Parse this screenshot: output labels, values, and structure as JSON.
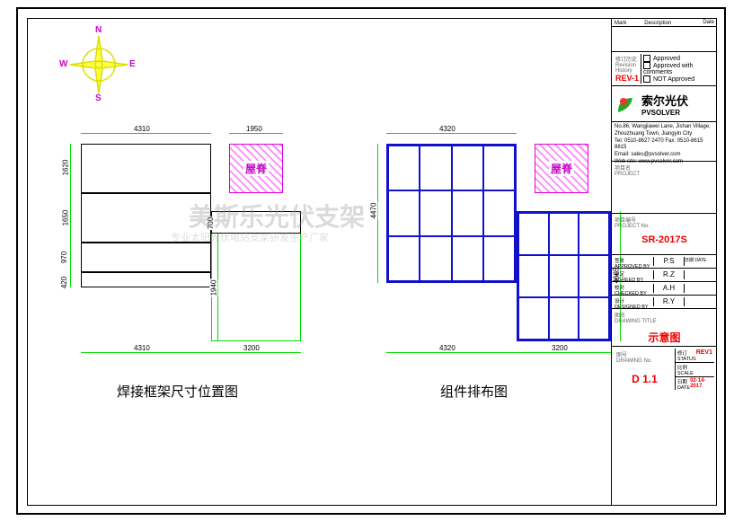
{
  "compass": {
    "n": "N",
    "s": "S",
    "e": "E",
    "w": "W"
  },
  "left_drawing": {
    "caption": "焊接框架尺寸位置图",
    "dims": {
      "top1": "4310",
      "top2": "1950",
      "bottom1": "4310",
      "bottom2": "3200",
      "left1": "1620",
      "left2": "1650",
      "left3": "970",
      "left4": "420",
      "right1": "700",
      "right2": "1940"
    },
    "hatch_label": "屋脊"
  },
  "right_drawing": {
    "caption": "组件排布图",
    "dims": {
      "top1": "4320",
      "bottom1": "4320",
      "bottom2": "3200",
      "right1": "4665",
      "left1": "4470"
    },
    "hatch_label": "屋脊"
  },
  "watermark": {
    "line1": "美斯乐光伏支架",
    "line2": "专业太阳光伏电站支架研发生产厂家"
  },
  "title_block": {
    "rev_header": {
      "mark": "Mark",
      "desc": "Description",
      "date": "Date"
    },
    "rev_history_label": "修订历史\nRevision History",
    "approval": {
      "a": "Approved",
      "b": "Approved with comments",
      "c": "NOT Approved"
    },
    "rev": "REV-1",
    "company_cn": "索尔光伏",
    "company_en": "PVSOLVER",
    "address": "No.86, Wangjiawei Lane, Jishan Village,\nZhouzhuang Town, Jiangyin City\nTel: 0510-8627 2470 Fax: 0510-8615 8815\nEmail: sales@pvsolver.com\nWeb site: www.pvsolver.com",
    "project_label": "项目名\nPROJECT",
    "project_no_label": "项目编号\nPROJECT No.",
    "project_no": "SR-2017S",
    "approved_by_label": "签发\nAPPROVED BY",
    "approved_by": "P.S",
    "agreed_by_label": "审定\nAGREED BY",
    "agreed_by": "R.Z",
    "checked_by_label": "校对\nCHECKED BY",
    "checked_by": "A.H",
    "designed_by_label": "设计\nDESIGNED BY",
    "designed_by": "R.Y",
    "date_col_label": "日期 DATE",
    "drawing_title_label": "图名\nDRAWING TITLE",
    "drawing_title": "示意图",
    "drawing_no_label": "图号\nDRAWING No.",
    "drawing_no": "D 1.1",
    "status_label": "修订\nSTATUS",
    "status": "REV1",
    "scale_label": "比例\nSCALE",
    "date_label": "日期\nDATE",
    "date_val": "02-14-2017"
  }
}
